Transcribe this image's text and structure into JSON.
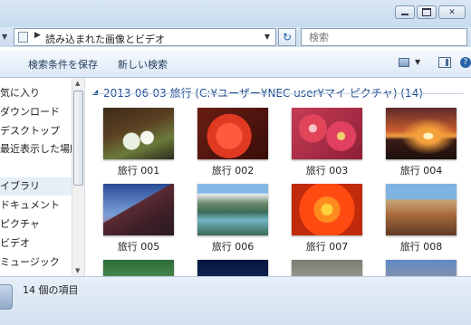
{
  "address": {
    "path_label": "読み込まれた画像とビデオ"
  },
  "search": {
    "placeholder": "検索"
  },
  "toolbar": {
    "save_search": "検索条件を保存",
    "new_search": "新しい検索"
  },
  "nav": {
    "items": [
      {
        "label": "気に入り"
      },
      {
        "label": "ダウンロード"
      },
      {
        "label": "デスクトップ"
      },
      {
        "label": "最近表示した場所"
      },
      {
        "label": "イブラリ"
      },
      {
        "label": "ドキュメント"
      },
      {
        "label": "ピクチャ"
      },
      {
        "label": "ビデオ"
      },
      {
        "label": "ミュージック"
      }
    ]
  },
  "group": {
    "title": "2013-06-03 旅行 (C:¥ユーザー¥NEC user¥マイ ピクチャ) (14)"
  },
  "files": [
    {
      "name": "旅行 001"
    },
    {
      "name": "旅行 002"
    },
    {
      "name": "旅行 003"
    },
    {
      "name": "旅行 004"
    },
    {
      "name": "旅行 005"
    },
    {
      "name": "旅行 006"
    },
    {
      "name": "旅行 007"
    },
    {
      "name": "旅行 008"
    }
  ],
  "status": {
    "item_count": "14 個の項目"
  },
  "icons": {
    "folder": "folder-icon",
    "refresh": "refresh-icon",
    "views": "views-icon",
    "preview": "preview-pane-icon",
    "help": "help-icon"
  }
}
